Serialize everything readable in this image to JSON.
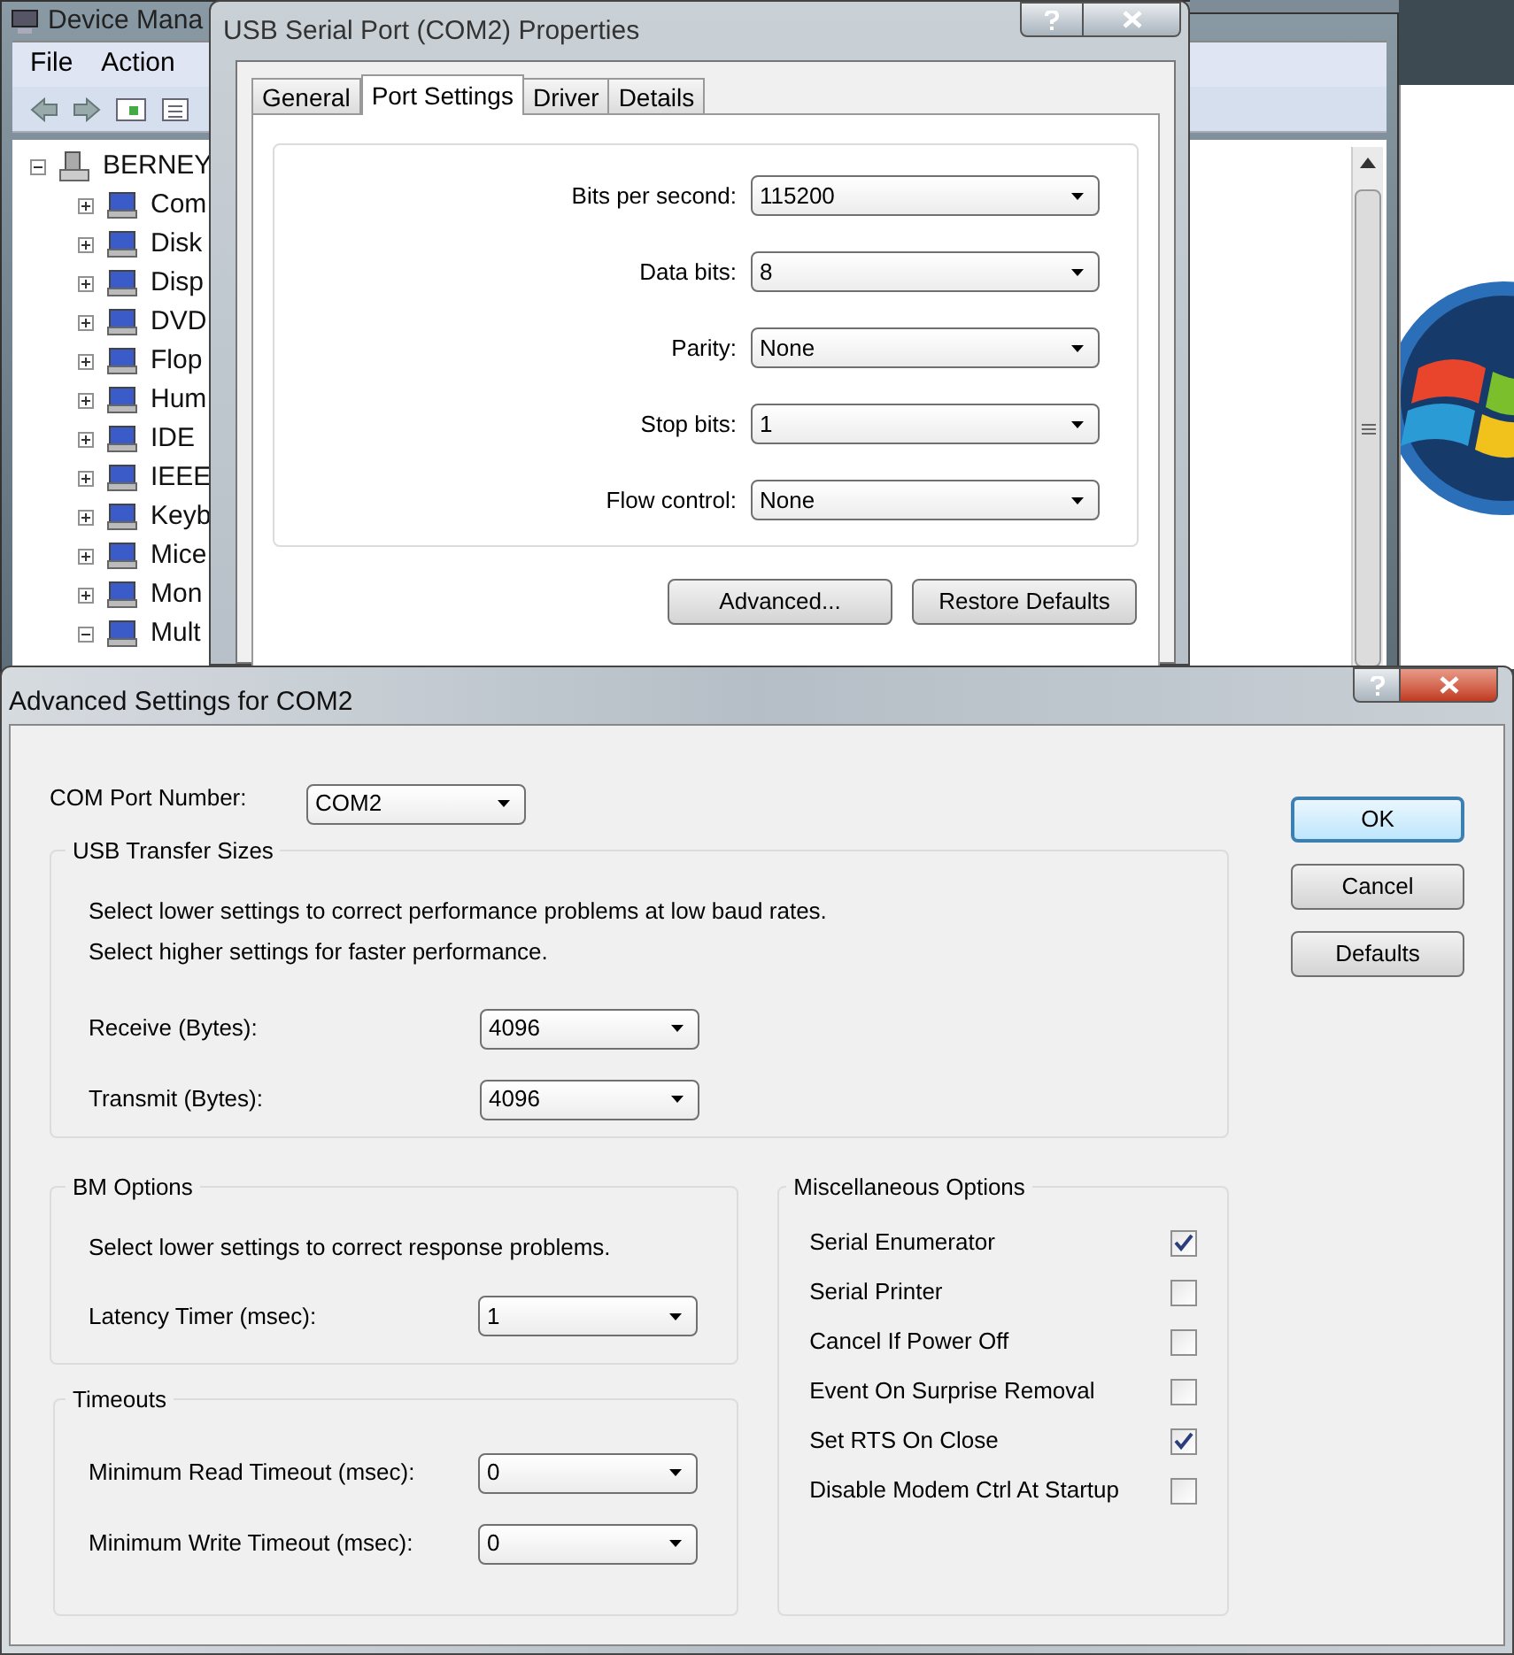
{
  "device_manager": {
    "title": "Device Mana",
    "menu": [
      "File",
      "Action"
    ],
    "tree": [
      {
        "label": "BERNEY",
        "expanded": true,
        "children": [
          {
            "label": "Com",
            "expanded": false
          },
          {
            "label": "Disk",
            "expanded": false
          },
          {
            "label": "Disp",
            "expanded": false
          },
          {
            "label": "DVD",
            "expanded": false
          },
          {
            "label": "Flop",
            "expanded": false
          },
          {
            "label": "Hum",
            "expanded": false
          },
          {
            "label": "IDE",
            "expanded": false
          },
          {
            "label": "IEEE",
            "expanded": false
          },
          {
            "label": "Keyb",
            "expanded": false
          },
          {
            "label": "Mice",
            "expanded": false
          },
          {
            "label": "Mon",
            "expanded": false
          },
          {
            "label": "Mult",
            "expanded": true
          }
        ]
      }
    ]
  },
  "properties_dialog": {
    "title": "USB Serial Port (COM2) Properties",
    "tabs": [
      {
        "label": "General",
        "selected": false
      },
      {
        "label": "Port Settings",
        "selected": true
      },
      {
        "label": "Driver",
        "selected": false
      },
      {
        "label": "Details",
        "selected": false
      }
    ],
    "fields": [
      {
        "label": "Bits per second:",
        "value": "115200"
      },
      {
        "label": "Data bits:",
        "value": "8"
      },
      {
        "label": "Parity:",
        "value": "None"
      },
      {
        "label": "Stop bits:",
        "value": "1"
      },
      {
        "label": "Flow control:",
        "value": "None"
      }
    ],
    "buttons": [
      "Advanced...",
      "Restore Defaults"
    ]
  },
  "advanced_dialog": {
    "title": "Advanced Settings for COM2",
    "com_port": {
      "label": "COM Port Number:",
      "value": "COM2"
    },
    "usb_transfer_sizes": {
      "title": "USB Transfer Sizes",
      "notes": [
        "Select lower settings to correct performance problems at low baud rates.",
        "Select higher settings for faster performance."
      ],
      "fields": [
        {
          "label": "Receive (Bytes):",
          "value": "4096"
        },
        {
          "label": "Transmit (Bytes):",
          "value": "4096"
        }
      ]
    },
    "bm_options": {
      "title": "BM Options",
      "notes": [
        "Select lower settings to correct response problems."
      ],
      "fields": [
        {
          "label": "Latency Timer (msec):",
          "value": "1"
        }
      ]
    },
    "timeouts": {
      "title": "Timeouts",
      "fields": [
        {
          "label": "Minimum Read Timeout (msec):",
          "value": "0"
        },
        {
          "label": "Minimum Write Timeout (msec):",
          "value": "0"
        }
      ]
    },
    "misc_options": {
      "title": "Miscellaneous Options",
      "items": [
        {
          "label": "Serial Enumerator",
          "checked": true
        },
        {
          "label": "Serial Printer",
          "checked": false
        },
        {
          "label": "Cancel If Power Off",
          "checked": false
        },
        {
          "label": "Event On Surprise Removal",
          "checked": false
        },
        {
          "label": "Set RTS On Close",
          "checked": true
        },
        {
          "label": "Disable Modem Ctrl At Startup",
          "checked": false
        }
      ]
    },
    "buttons": [
      {
        "label": "OK",
        "default": true
      },
      {
        "label": "Cancel",
        "default": false
      },
      {
        "label": "Defaults",
        "default": false
      }
    ]
  }
}
